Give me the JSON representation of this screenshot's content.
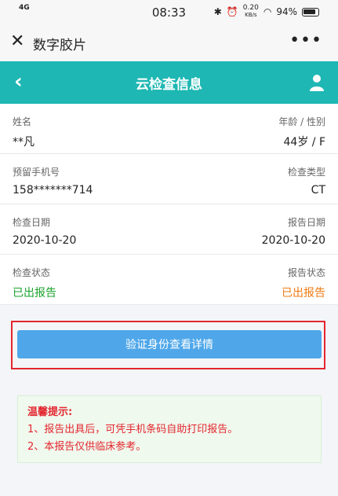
{
  "status_bar": {
    "network": "4G",
    "time": "08:33",
    "speed": "0.20",
    "speed_unit": "KB/s",
    "battery": "94%"
  },
  "wechat_bar": {
    "title": "数字胶片",
    "more": "•••"
  },
  "header": {
    "title": "云检查信息"
  },
  "info_rows": [
    {
      "left_label": "姓名",
      "left_value": "**凡",
      "right_label": "年龄 / 性别",
      "right_value": "44岁 / F"
    },
    {
      "left_label": "预留手机号",
      "left_value": "158*******714",
      "right_label": "检查类型",
      "right_value": "CT"
    },
    {
      "left_label": "检查日期",
      "left_value": "2020-10-20",
      "right_label": "报告日期",
      "right_value": "2020-10-20"
    },
    {
      "left_label": "检查状态",
      "left_value": "已出报告",
      "right_label": "报告状态",
      "right_value": "已出报告"
    }
  ],
  "verify_button": "验证身份查看详情",
  "tips": {
    "title": "温馨提示:",
    "line1": "1、报告出具后，可凭手机条码自助打印报告。",
    "line2": "2、本报告仅供临床参考。"
  },
  "colors": {
    "header": "#1eb7b3",
    "button": "#4fa7ea",
    "status_green": "#19a32b",
    "status_orange": "#f07a10",
    "tip_red": "#e3262f"
  }
}
